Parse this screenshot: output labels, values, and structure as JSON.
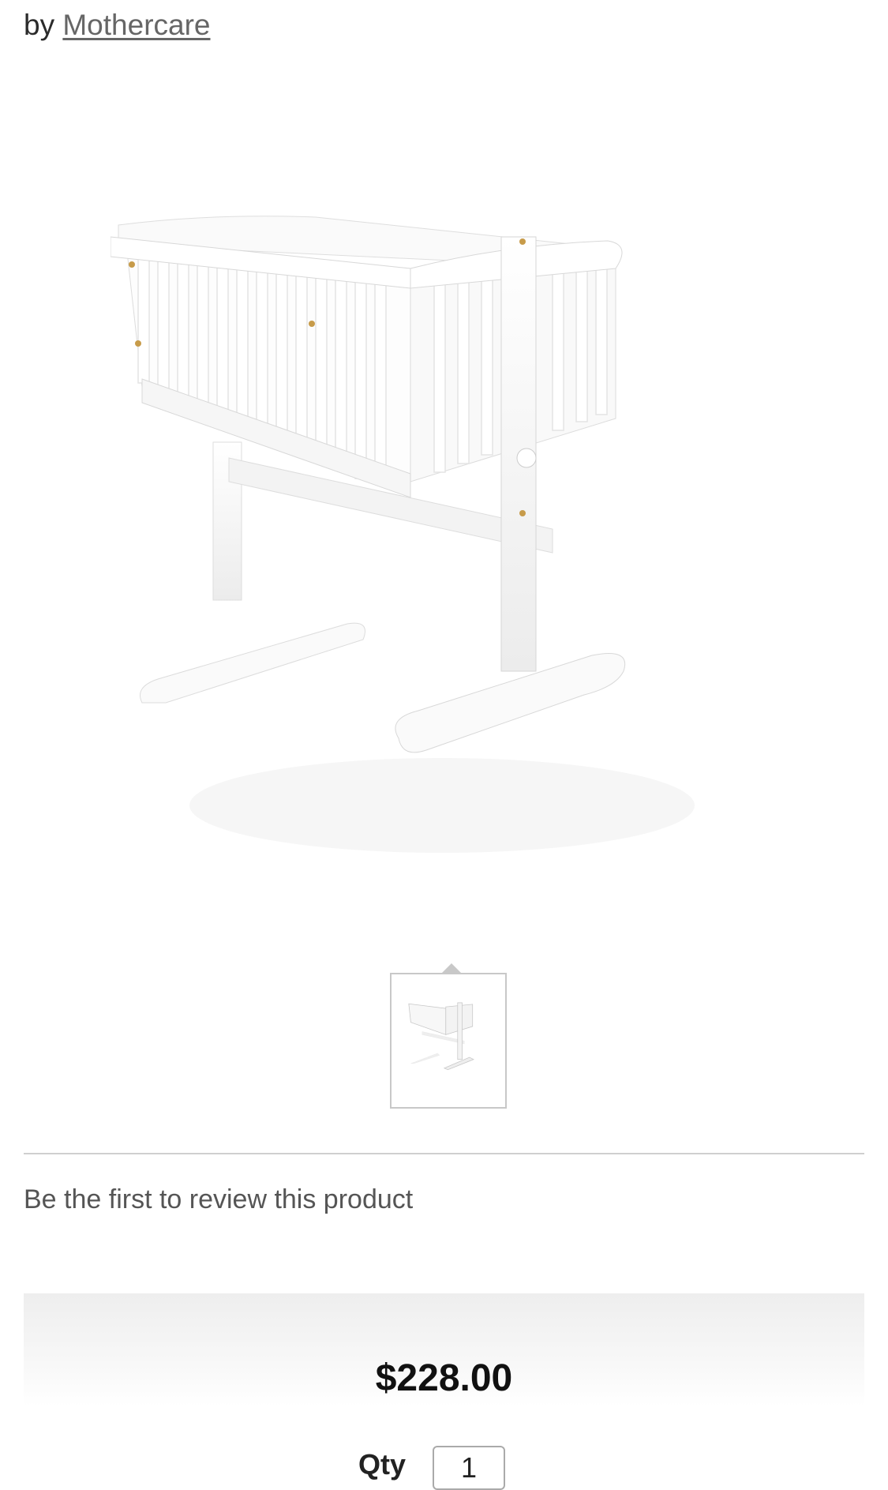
{
  "brand": {
    "prefix": "by",
    "name": "Mothercare"
  },
  "product": {
    "image_alt": "white wooden swinging crib",
    "thumbnail_alt": "white wooden swinging crib thumbnail"
  },
  "reviews": {
    "cta": "Be the first to review this product"
  },
  "purchase": {
    "price": "$228.00",
    "qty_label": "Qty",
    "qty_value": "1"
  },
  "colors": {
    "crib_white": "#f8f8f8",
    "crib_edge": "#dcdcdc",
    "screw_gold": "#c79b4a"
  }
}
